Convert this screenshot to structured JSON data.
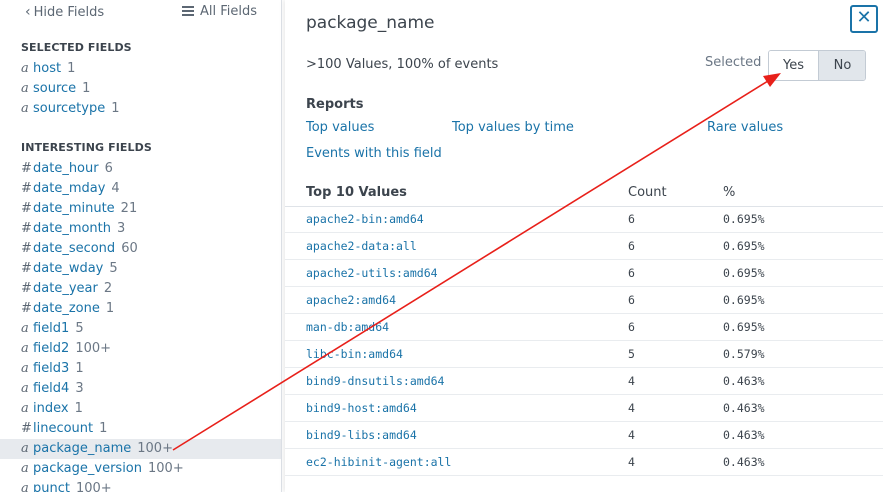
{
  "sidebar": {
    "hide_fields": "Hide Fields",
    "all_fields": "All Fields",
    "selected_title": "SELECTED FIELDS",
    "selected": [
      {
        "type": "a",
        "name": "host",
        "count": "1"
      },
      {
        "type": "a",
        "name": "source",
        "count": "1"
      },
      {
        "type": "a",
        "name": "sourcetype",
        "count": "1"
      }
    ],
    "interesting_title": "INTERESTING FIELDS",
    "interesting": [
      {
        "type": "#",
        "name": "date_hour",
        "count": "6"
      },
      {
        "type": "#",
        "name": "date_mday",
        "count": "4"
      },
      {
        "type": "#",
        "name": "date_minute",
        "count": "21"
      },
      {
        "type": "#",
        "name": "date_month",
        "count": "3"
      },
      {
        "type": "#",
        "name": "date_second",
        "count": "60"
      },
      {
        "type": "#",
        "name": "date_wday",
        "count": "5"
      },
      {
        "type": "#",
        "name": "date_year",
        "count": "2"
      },
      {
        "type": "#",
        "name": "date_zone",
        "count": "1"
      },
      {
        "type": "a",
        "name": "field1",
        "count": "5"
      },
      {
        "type": "a",
        "name": "field2",
        "count": "100+"
      },
      {
        "type": "a",
        "name": "field3",
        "count": "1"
      },
      {
        "type": "a",
        "name": "field4",
        "count": "3"
      },
      {
        "type": "a",
        "name": "index",
        "count": "1"
      },
      {
        "type": "#",
        "name": "linecount",
        "count": "1"
      },
      {
        "type": "a",
        "name": "package_name",
        "count": "100+",
        "active": true
      },
      {
        "type": "a",
        "name": "package_version",
        "count": "100+"
      },
      {
        "type": "a",
        "name": "punct",
        "count": "100+"
      }
    ]
  },
  "panel": {
    "title": "package_name",
    "close_glyph": "✕",
    "summary": ">100 Values, 100% of events",
    "selected_label": "Selected",
    "yes": "Yes",
    "no": "No",
    "reports_title": "Reports",
    "report_links": {
      "top_values": "Top values",
      "top_values_by_time": "Top values by time",
      "rare_values": "Rare values",
      "events_with_field": "Events with this field"
    },
    "table": {
      "col_value": "Top 10 Values",
      "col_count": "Count",
      "col_pct": "%",
      "rows": [
        {
          "value": "apache2-bin:amd64",
          "count": "6",
          "pct": "0.695%"
        },
        {
          "value": "apache2-data:all",
          "count": "6",
          "pct": "0.695%"
        },
        {
          "value": "apache2-utils:amd64",
          "count": "6",
          "pct": "0.695%"
        },
        {
          "value": "apache2:amd64",
          "count": "6",
          "pct": "0.695%"
        },
        {
          "value": "man-db:amd64",
          "count": "6",
          "pct": "0.695%"
        },
        {
          "value": "libc-bin:amd64",
          "count": "5",
          "pct": "0.579%"
        },
        {
          "value": "bind9-dnsutils:amd64",
          "count": "4",
          "pct": "0.463%"
        },
        {
          "value": "bind9-host:amd64",
          "count": "4",
          "pct": "0.463%"
        },
        {
          "value": "bind9-libs:amd64",
          "count": "4",
          "pct": "0.463%"
        },
        {
          "value": "ec2-hibinit-agent:all",
          "count": "4",
          "pct": "0.463%"
        }
      ]
    }
  },
  "colors": {
    "link": "#1a73a8",
    "annotation_arrow": "#e8201a"
  }
}
